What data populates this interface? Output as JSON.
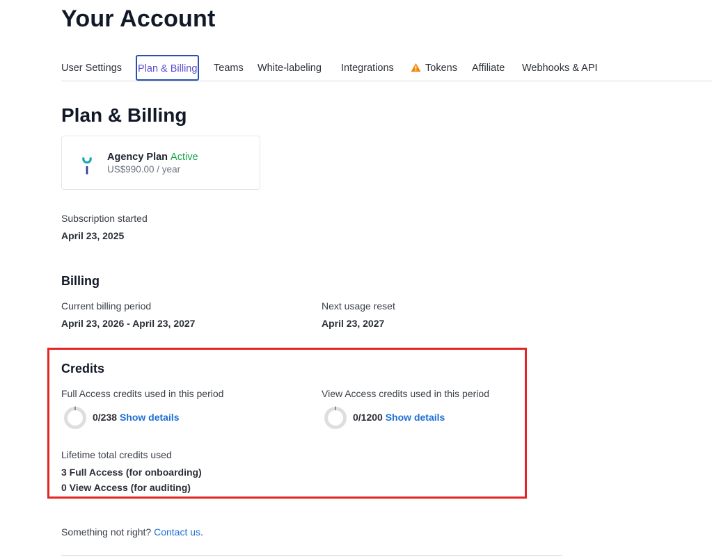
{
  "header": {
    "title": "Your Account"
  },
  "tabs": [
    {
      "label": "User Settings"
    },
    {
      "label": "Plan & Billing"
    },
    {
      "label": "Teams"
    },
    {
      "label": "White-labeling"
    },
    {
      "label": "Integrations"
    },
    {
      "label": "Tokens",
      "icon": "warning-icon"
    },
    {
      "label": "Affiliate"
    },
    {
      "label": "Webhooks & API"
    }
  ],
  "active_tab": "Plan & Billing",
  "section": {
    "title": "Plan & Billing"
  },
  "plan": {
    "name": "Agency Plan",
    "status": "Active",
    "price": "US$990.00 / year"
  },
  "subscription": {
    "label": "Subscription started",
    "date": "April 23, 2025"
  },
  "billing": {
    "title": "Billing",
    "current_period_label": "Current billing period",
    "current_period_value": "April 23, 2026 - April 23, 2027",
    "next_reset_label": "Next usage reset",
    "next_reset_value": "April 23, 2027"
  },
  "credits": {
    "title": "Credits",
    "full_access": {
      "label": "Full Access credits used in this period",
      "count": "0/238",
      "used": 0,
      "total": 238,
      "link": "Show details"
    },
    "view_access": {
      "label": "View Access credits used in this period",
      "count": "0/1200",
      "used": 0,
      "total": 1200,
      "link": "Show details"
    },
    "lifetime": {
      "label": "Lifetime total credits used",
      "full": "3 Full Access (for onboarding)",
      "view": "0 View Access (for auditing)"
    }
  },
  "footer": {
    "text": "Something not right?",
    "link": "Contact us",
    "suffix": "."
  },
  "colors": {
    "accent": "#1d6fd6",
    "active_tab_border": "#2a4fb0",
    "active_tab_text": "#5a4fc9",
    "status_active": "#16a34a",
    "highlight_border": "#e52424",
    "warning": "#f2860a",
    "logo_teal": "#19a7b8",
    "logo_indigo": "#3b3f9a"
  }
}
